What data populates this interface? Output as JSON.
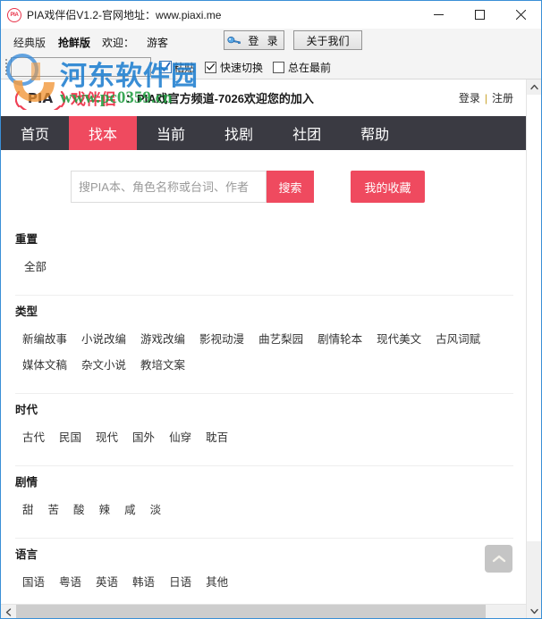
{
  "window": {
    "title": "PIA戏伴侣V1.2-官网地址：www.piaxi.me",
    "app_icon_text": "PIA",
    "controls": {
      "minimize": "minimize-icon",
      "maximize": "maximize-icon",
      "close": "close-icon"
    }
  },
  "toolbar": {
    "classic_tab": "经典版",
    "beta_tab": "抢鲜版",
    "welcome_label": "欢迎：",
    "guest_label": "游客",
    "login_button": "登 录",
    "about_button": "关于我们",
    "paste_input_value": "",
    "paste_button": "粘贴",
    "quick_switch": {
      "label": "快速切换",
      "checked": true
    },
    "always_on_top": {
      "label": "总在最前",
      "checked": false
    }
  },
  "watermark": {
    "site_name": "河东软件园",
    "site_url": "www.pc0359.cn",
    "site_name_color": "#1f7fd0",
    "site_url_color": "#1f9e3f"
  },
  "site": {
    "logo": {
      "mark": "PIA",
      "name": "戏伴侣",
      "name_color": "#ef3f55"
    },
    "announcement": "：PIA戏官方频道-7026欢迎您的加入",
    "auth": {
      "login": "登录",
      "separator": "|",
      "register": "注册"
    },
    "nav": {
      "active_index": 1,
      "items": [
        {
          "label": "首页"
        },
        {
          "label": "找本"
        },
        {
          "label": "当前"
        },
        {
          "label": "找剧"
        },
        {
          "label": "社团"
        },
        {
          "label": "帮助"
        }
      ]
    },
    "search": {
      "placeholder": "搜PIA本、角色名称或台词、作者",
      "value": "",
      "search_button": "搜索",
      "favorites_button": "我的收藏"
    },
    "filters": [
      {
        "title": "重置",
        "options": [
          "全部"
        ]
      },
      {
        "title": "类型",
        "options": [
          "新编故事",
          "小说改编",
          "游戏改编",
          "影视动漫",
          "曲艺梨园",
          "剧情轮本",
          "现代美文",
          "古风词赋",
          "媒体文稿",
          "杂文小说",
          "教培文案"
        ]
      },
      {
        "title": "时代",
        "options": [
          "古代",
          "民国",
          "现代",
          "国外",
          "仙穿",
          "耽百"
        ]
      },
      {
        "title": "剧情",
        "options": [
          "甜",
          "苦",
          "酸",
          "辣",
          "咸",
          "淡"
        ]
      },
      {
        "title": "语言",
        "options": [
          "国语",
          "粤语",
          "英语",
          "韩语",
          "日语",
          "其他"
        ]
      }
    ],
    "back_to_top": "chevron-up-icon"
  },
  "theme": {
    "accent": "#ef4a5f",
    "nav_background": "#3a3a42",
    "window_border": "#3a8fd6"
  }
}
